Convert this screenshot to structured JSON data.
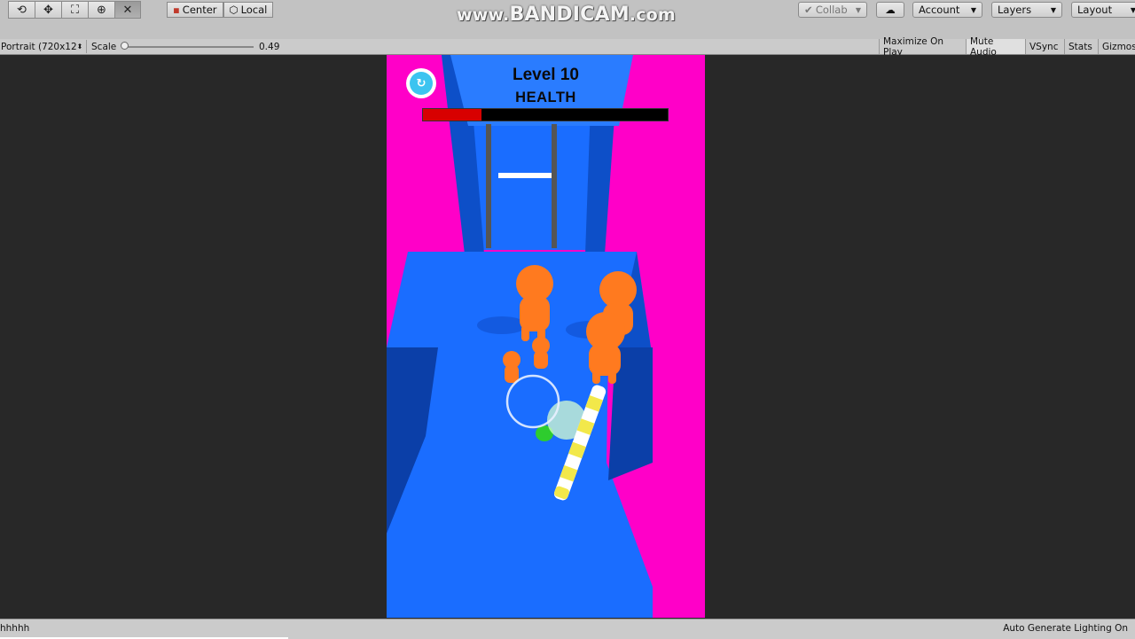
{
  "toolbar": {
    "tools": [
      {
        "icon": "hand-icon",
        "glyph": "⟲"
      },
      {
        "icon": "move-icon",
        "glyph": "✥"
      },
      {
        "icon": "rect-tool-icon",
        "glyph": "⛶"
      },
      {
        "icon": "transform-icon",
        "glyph": "⊕"
      },
      {
        "icon": "custom-tool-icon",
        "glyph": "✕"
      }
    ],
    "pivot_label": "Center",
    "rotation_label": "Local",
    "collab_label": "Collab",
    "account_label": "Account",
    "layers_label": "Layers",
    "layout_label": "Layout",
    "watermark_prefix": "www.",
    "watermark_brand": "BANDICAM",
    "watermark_suffix": ".com"
  },
  "game_view_bar": {
    "aspect_label": "Portrait (720x12",
    "scale_label": "Scale",
    "scale_value": "0.49",
    "toggles": [
      "Maximize On Play",
      "Mute Audio",
      "VSync",
      "Stats",
      "Gizmos"
    ],
    "active_toggle": "Mute Audio"
  },
  "game": {
    "level_text": "Level 10",
    "health_label": "HEALTH",
    "health_fraction": 0.24,
    "colors": {
      "wall": "#ff00c8",
      "floor": "#1a6dff",
      "health_fill": "#d80000",
      "enemy": "#ff7a1f",
      "player": "#2ecc2e",
      "restart": "#3cc4f0"
    }
  },
  "status_bar": {
    "left_text": "hhhhh",
    "right_text": "Auto Generate Lighting On"
  }
}
